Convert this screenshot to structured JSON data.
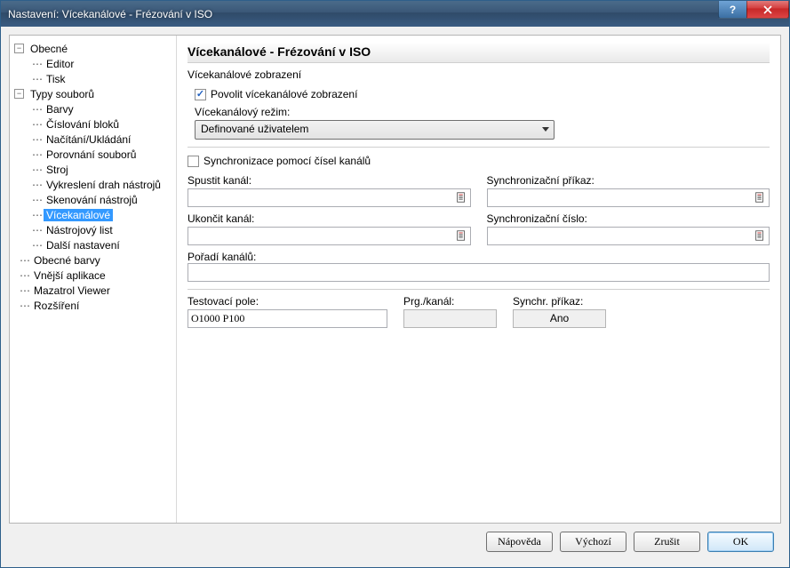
{
  "window": {
    "title": "Nastavení: Vícekanálové - Frézování v ISO"
  },
  "tree": {
    "n0": {
      "label": "Obecné"
    },
    "n0a": {
      "label": "Editor"
    },
    "n0b": {
      "label": "Tisk"
    },
    "n1": {
      "label": "Typy souborů"
    },
    "n1a": {
      "label": "Barvy"
    },
    "n1b": {
      "label": "Číslování bloků"
    },
    "n1c": {
      "label": "Načítání/Ukládání"
    },
    "n1d": {
      "label": "Porovnání souborů"
    },
    "n1e": {
      "label": "Stroj"
    },
    "n1f": {
      "label": "Vykreslení drah nástrojů"
    },
    "n1g": {
      "label": "Skenování nástrojů"
    },
    "n1h": {
      "label": "Vícekanálové"
    },
    "n1i": {
      "label": "Nástrojový list"
    },
    "n1j": {
      "label": "Další nastavení"
    },
    "n2": {
      "label": "Obecné barvy"
    },
    "n3": {
      "label": "Vnější aplikace"
    },
    "n4": {
      "label": "Mazatrol Viewer"
    },
    "n5": {
      "label": "Rozšíření"
    }
  },
  "panel": {
    "heading": "Vícekanálové - Frézování v ISO",
    "group_display": "Vícekanálové zobrazení",
    "enable_label": "Povolit vícekanálové zobrazení",
    "mode_label": "Vícekanálový režim:",
    "mode_value": "Definované uživatelem",
    "sync_numbers_label": "Synchronizace pomocí čísel kanálů",
    "start_channel_label": "Spustit kanál:",
    "start_channel_value": "",
    "sync_cmd_label": "Synchronizační příkaz:",
    "sync_cmd_value": "",
    "end_channel_label": "Ukončit kanál:",
    "end_channel_value": "",
    "sync_num_label": "Synchronizační číslo:",
    "sync_num_value": "",
    "order_label": "Pořadí kanálů:",
    "order_value": "",
    "test_field_label": "Testovací pole:",
    "test_field_value": "O1000 P100",
    "prg_channel_label": "Prg./kanál:",
    "prg_channel_value": "",
    "sync_cmd2_label": "Synchr. příkaz:",
    "sync_cmd2_value": "Ano"
  },
  "footer": {
    "help": "Nápověda",
    "default": "Výchozí",
    "cancel": "Zrušit",
    "ok": "OK"
  }
}
